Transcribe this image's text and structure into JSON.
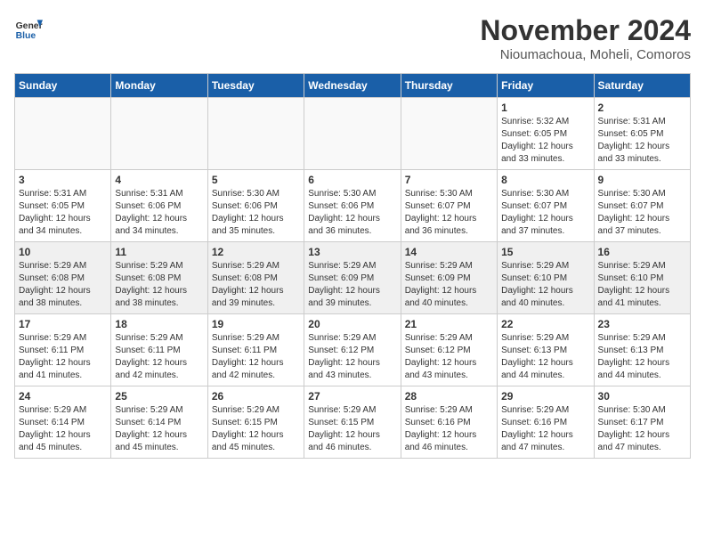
{
  "logo": {
    "text_general": "General",
    "text_blue": "Blue"
  },
  "header": {
    "month": "November 2024",
    "location": "Nioumachoua, Moheli, Comoros"
  },
  "weekdays": [
    "Sunday",
    "Monday",
    "Tuesday",
    "Wednesday",
    "Thursday",
    "Friday",
    "Saturday"
  ],
  "weeks": [
    [
      {
        "day": "",
        "info": ""
      },
      {
        "day": "",
        "info": ""
      },
      {
        "day": "",
        "info": ""
      },
      {
        "day": "",
        "info": ""
      },
      {
        "day": "",
        "info": ""
      },
      {
        "day": "1",
        "info": "Sunrise: 5:32 AM\nSunset: 6:05 PM\nDaylight: 12 hours and 33 minutes."
      },
      {
        "day": "2",
        "info": "Sunrise: 5:31 AM\nSunset: 6:05 PM\nDaylight: 12 hours and 33 minutes."
      }
    ],
    [
      {
        "day": "3",
        "info": "Sunrise: 5:31 AM\nSunset: 6:05 PM\nDaylight: 12 hours and 34 minutes."
      },
      {
        "day": "4",
        "info": "Sunrise: 5:31 AM\nSunset: 6:06 PM\nDaylight: 12 hours and 34 minutes."
      },
      {
        "day": "5",
        "info": "Sunrise: 5:30 AM\nSunset: 6:06 PM\nDaylight: 12 hours and 35 minutes."
      },
      {
        "day": "6",
        "info": "Sunrise: 5:30 AM\nSunset: 6:06 PM\nDaylight: 12 hours and 36 minutes."
      },
      {
        "day": "7",
        "info": "Sunrise: 5:30 AM\nSunset: 6:07 PM\nDaylight: 12 hours and 36 minutes."
      },
      {
        "day": "8",
        "info": "Sunrise: 5:30 AM\nSunset: 6:07 PM\nDaylight: 12 hours and 37 minutes."
      },
      {
        "day": "9",
        "info": "Sunrise: 5:30 AM\nSunset: 6:07 PM\nDaylight: 12 hours and 37 minutes."
      }
    ],
    [
      {
        "day": "10",
        "info": "Sunrise: 5:29 AM\nSunset: 6:08 PM\nDaylight: 12 hours and 38 minutes."
      },
      {
        "day": "11",
        "info": "Sunrise: 5:29 AM\nSunset: 6:08 PM\nDaylight: 12 hours and 38 minutes."
      },
      {
        "day": "12",
        "info": "Sunrise: 5:29 AM\nSunset: 6:08 PM\nDaylight: 12 hours and 39 minutes."
      },
      {
        "day": "13",
        "info": "Sunrise: 5:29 AM\nSunset: 6:09 PM\nDaylight: 12 hours and 39 minutes."
      },
      {
        "day": "14",
        "info": "Sunrise: 5:29 AM\nSunset: 6:09 PM\nDaylight: 12 hours and 40 minutes."
      },
      {
        "day": "15",
        "info": "Sunrise: 5:29 AM\nSunset: 6:10 PM\nDaylight: 12 hours and 40 minutes."
      },
      {
        "day": "16",
        "info": "Sunrise: 5:29 AM\nSunset: 6:10 PM\nDaylight: 12 hours and 41 minutes."
      }
    ],
    [
      {
        "day": "17",
        "info": "Sunrise: 5:29 AM\nSunset: 6:11 PM\nDaylight: 12 hours and 41 minutes."
      },
      {
        "day": "18",
        "info": "Sunrise: 5:29 AM\nSunset: 6:11 PM\nDaylight: 12 hours and 42 minutes."
      },
      {
        "day": "19",
        "info": "Sunrise: 5:29 AM\nSunset: 6:11 PM\nDaylight: 12 hours and 42 minutes."
      },
      {
        "day": "20",
        "info": "Sunrise: 5:29 AM\nSunset: 6:12 PM\nDaylight: 12 hours and 43 minutes."
      },
      {
        "day": "21",
        "info": "Sunrise: 5:29 AM\nSunset: 6:12 PM\nDaylight: 12 hours and 43 minutes."
      },
      {
        "day": "22",
        "info": "Sunrise: 5:29 AM\nSunset: 6:13 PM\nDaylight: 12 hours and 44 minutes."
      },
      {
        "day": "23",
        "info": "Sunrise: 5:29 AM\nSunset: 6:13 PM\nDaylight: 12 hours and 44 minutes."
      }
    ],
    [
      {
        "day": "24",
        "info": "Sunrise: 5:29 AM\nSunset: 6:14 PM\nDaylight: 12 hours and 45 minutes."
      },
      {
        "day": "25",
        "info": "Sunrise: 5:29 AM\nSunset: 6:14 PM\nDaylight: 12 hours and 45 minutes."
      },
      {
        "day": "26",
        "info": "Sunrise: 5:29 AM\nSunset: 6:15 PM\nDaylight: 12 hours and 45 minutes."
      },
      {
        "day": "27",
        "info": "Sunrise: 5:29 AM\nSunset: 6:15 PM\nDaylight: 12 hours and 46 minutes."
      },
      {
        "day": "28",
        "info": "Sunrise: 5:29 AM\nSunset: 6:16 PM\nDaylight: 12 hours and 46 minutes."
      },
      {
        "day": "29",
        "info": "Sunrise: 5:29 AM\nSunset: 6:16 PM\nDaylight: 12 hours and 47 minutes."
      },
      {
        "day": "30",
        "info": "Sunrise: 5:30 AM\nSunset: 6:17 PM\nDaylight: 12 hours and 47 minutes."
      }
    ]
  ]
}
